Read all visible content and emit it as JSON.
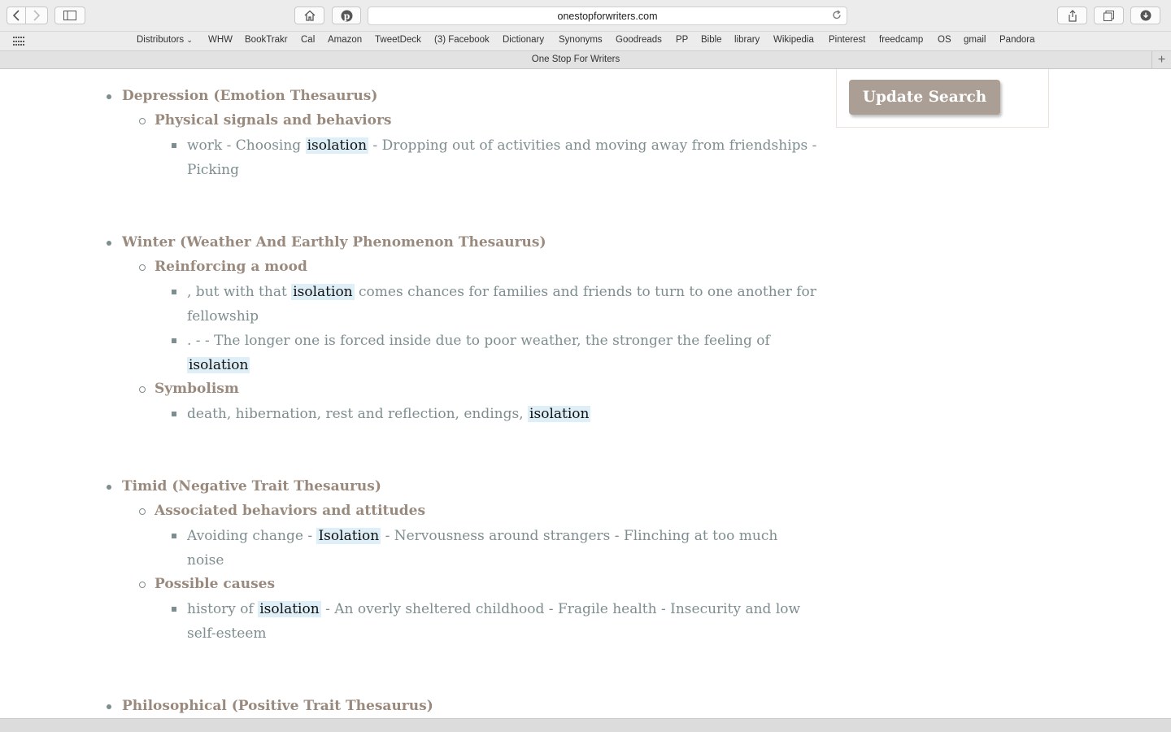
{
  "browser": {
    "url": "onestopforwriters.com",
    "tab_title": "One Stop For Writers",
    "bookmarks": [
      "Distributors",
      "WHW",
      "BookTrakr",
      "Cal",
      "Amazon",
      "TweetDeck",
      "(3) Facebook",
      "Dictionary",
      "Synonyms",
      "Goodreads",
      "PP",
      "Bible",
      "library",
      "Wikipedia",
      "Pinterest",
      "freedcamp",
      "OS",
      "gmail",
      "Pandora"
    ]
  },
  "sidebar": {
    "update_button": "Update Search"
  },
  "results": [
    {
      "category": "Depression (Emotion Thesaurus)",
      "sections": [
        {
          "heading": "Physical signals and behaviors",
          "items": [
            {
              "before": "work - Choosing ",
              "hit": "isolation",
              "after": " - Dropping out of activities and moving away from friendships - Picking"
            }
          ]
        }
      ]
    },
    {
      "category": "Winter (Weather And Earthly Phenomenon Thesaurus)",
      "sections": [
        {
          "heading": "Reinforcing a mood",
          "items": [
            {
              "before": ", but with that ",
              "hit": "isolation",
              "after": " comes chances for families and friends to turn to one another for fellowship"
            },
            {
              "before": ". - - The longer one is forced inside due to poor weather, the stronger the feeling of ",
              "hit": "isolation",
              "after": ""
            }
          ]
        },
        {
          "heading": "Symbolism",
          "items": [
            {
              "before": "death, hibernation, rest and reflection, endings, ",
              "hit": "isolation",
              "after": ""
            }
          ]
        }
      ]
    },
    {
      "category": "Timid (Negative Trait Thesaurus)",
      "sections": [
        {
          "heading": "Associated behaviors and attitudes",
          "items": [
            {
              "before": "Avoiding change - ",
              "hit": "Isolation",
              "after": " - Nervousness around strangers - Flinching at too much noise"
            }
          ]
        },
        {
          "heading": "Possible causes",
          "items": [
            {
              "before": "history of ",
              "hit": "isolation",
              "after": " - An overly sheltered childhood - Fragile health - Insecurity and low self-esteem"
            }
          ]
        }
      ]
    },
    {
      "category": "Philosophical (Positive Trait Thesaurus)",
      "sections": []
    }
  ]
}
